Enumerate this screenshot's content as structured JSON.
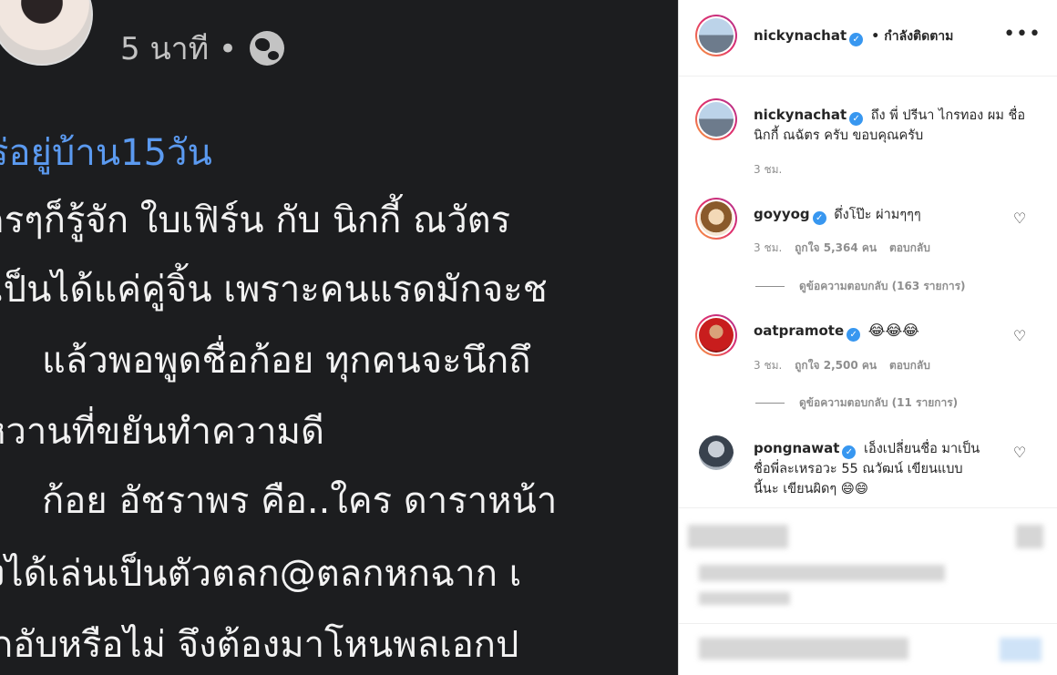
{
  "photo": {
    "time": "5 นาที •",
    "lines": [
      "ร่อยู่บ้าน15วัน",
      "ครๆก็รู้จัก ใบเฟิร์น กับ นิกกี้ ณวัตร",
      "เป็นได้แค่คู่จิ้น เพราะคนแรดมักจะช",
      "แล้วพอพูดชื่อก้อย ทุกคนจะนึกถึ",
      "หวานที่ขยันทำความดี",
      "ก้อย อัชราพร คือ..ใคร ดาราหน้า",
      "งได้เล่นเป็นตัวตลก@ตลกหกฉาก เ",
      "กอับหรือไม่ จึงต้องมาโหนพลเอกป"
    ]
  },
  "header": {
    "username": "nickynachat",
    "separator": "•",
    "follow_status": "กำลังติดตาม",
    "more_icon": "more-dots-icon"
  },
  "caption": {
    "username": "nickynachat",
    "text": "ถึง พี่ ปรีนา ไกรทอง ผม ชื่อ นิกกี้ ณฉัตร ครับ ขอบคุณครับ",
    "time": "3 ชม."
  },
  "comments": [
    {
      "username": "goyyog",
      "text": "ดึ่งโป๊ะ ผ่ามๆๆๆ",
      "time": "3 ชม.",
      "likes": "ถูกใจ 5,364 คน",
      "reply": "ตอบกลับ",
      "view_replies": "ดูข้อความตอบกลับ (163 รายการ)"
    },
    {
      "username": "oatpramote",
      "text": "😂😂😂",
      "time": "3 ชม.",
      "likes": "ถูกใจ 2,500 คน",
      "reply": "ตอบกลับ",
      "view_replies": "ดูข้อความตอบกลับ (11 รายการ)"
    },
    {
      "username": "pongnawat",
      "text_line1": "เอ็งเปลี่ยนชื่อ มาเป็น",
      "text_line2": "ชื่อพี่ละเหรอวะ 55 ณวัฒน์ เขียนแบบ",
      "text_line3": "นี้นะ เขียนผิดๆ 😄😄"
    }
  ],
  "colors": {
    "photo_bg": "#1c1d1f",
    "hashtag": "#5b9af0",
    "verified": "#3897f0",
    "muted_text": "#8e8e8e"
  }
}
